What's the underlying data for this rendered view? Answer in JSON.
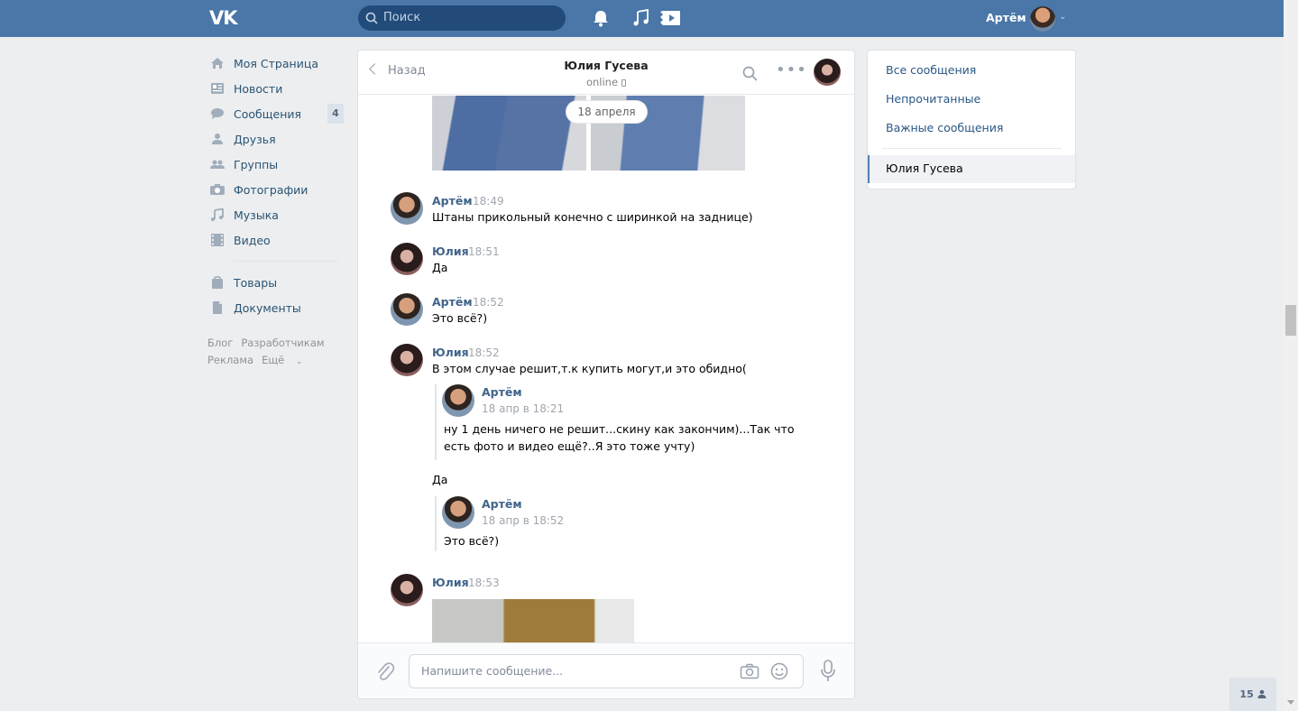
{
  "topbar": {
    "logo": "VK",
    "search_placeholder": "Поиск",
    "user_name": "Артём"
  },
  "leftnav": {
    "items": [
      {
        "label": "Моя Страница",
        "icon": "home-icon"
      },
      {
        "label": "Новости",
        "icon": "news-icon"
      },
      {
        "label": "Сообщения",
        "icon": "messages-icon",
        "badge": "4"
      },
      {
        "label": "Друзья",
        "icon": "friends-icon"
      },
      {
        "label": "Группы",
        "icon": "groups-icon"
      },
      {
        "label": "Фотографии",
        "icon": "camera-icon"
      },
      {
        "label": "Музыка",
        "icon": "music-icon"
      },
      {
        "label": "Видео",
        "icon": "video-icon"
      }
    ],
    "items2": [
      {
        "label": "Товары",
        "icon": "bag-icon"
      },
      {
        "label": "Документы",
        "icon": "document-icon"
      }
    ],
    "footer": [
      "Блог",
      "Разработчикам",
      "Реклама",
      "Ещё"
    ]
  },
  "chat": {
    "back_label": "Назад",
    "peer_name": "Юлия Гусева",
    "peer_status": "online",
    "date_pill": "18 апреля",
    "messages": [
      {
        "author": "Артём",
        "time": "18:49",
        "text": "Штаны прикольный конечно с ширинкой на заднице)"
      },
      {
        "author": "Юлия",
        "time": "18:51",
        "text": "Да"
      },
      {
        "author": "Артём",
        "time": "18:52",
        "text": "Это всё?)"
      },
      {
        "author": "Юлия",
        "time": "18:52",
        "text": "В этом случае решит,т.к купить могут,и это обидно("
      },
      {
        "author": "Юлия",
        "time": "18:53",
        "text": ""
      }
    ],
    "forward1": {
      "author": "Артём",
      "time": "18 апр в 18:21",
      "line1": "ну 1 день ничего не решит...скину как закончим)...Так что",
      "line2": "есть фото и видео ещё?..Я это тоже учту)"
    },
    "reply_text": "Да",
    "forward2": {
      "author": "Артём",
      "time": "18 апр в 18:52",
      "line1": "Это всё?)"
    },
    "compose_placeholder": "Напишите сообщение..."
  },
  "rightpanel": {
    "items": [
      "Все сообщения",
      "Непрочитанные",
      "Важные сообщения"
    ],
    "active": "Юлия Гусева"
  },
  "online_count": "15",
  "colors": {
    "brand": "#4a76a8",
    "link": "#2a5885",
    "author": "#42648b"
  }
}
